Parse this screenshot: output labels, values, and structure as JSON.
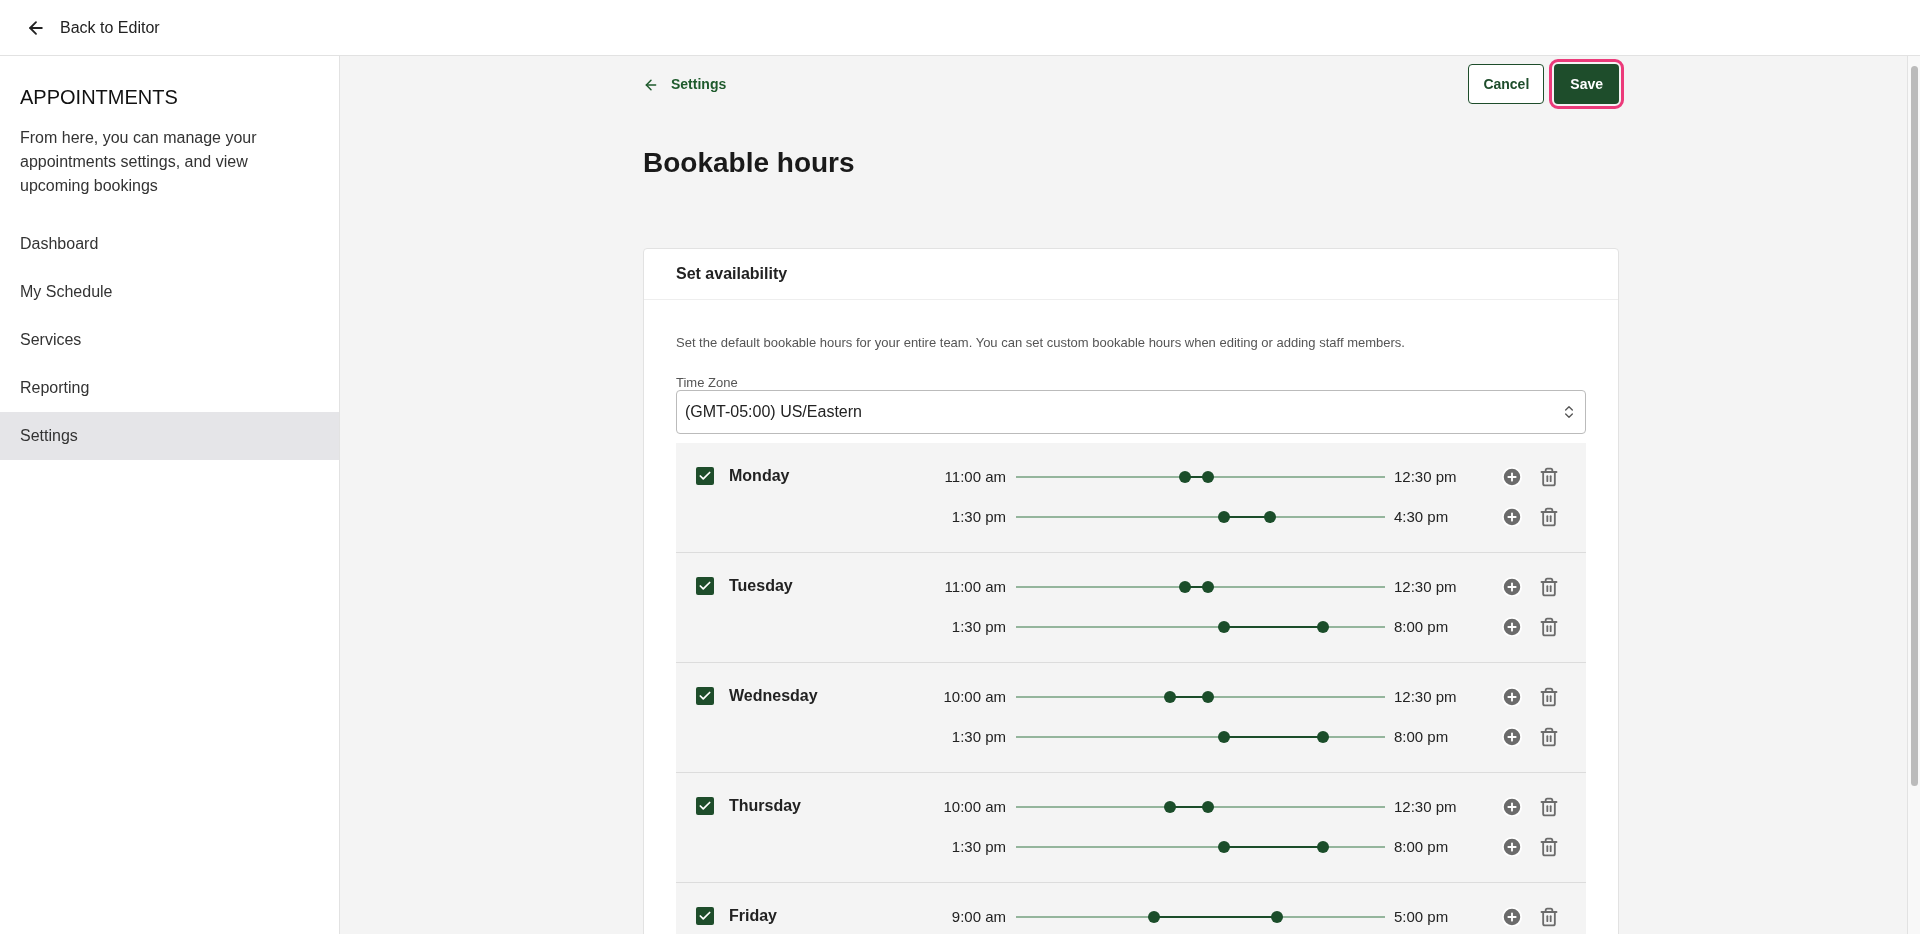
{
  "top_bar": {
    "back_link": "Back to Editor"
  },
  "sidebar": {
    "title": "APPOINTMENTS",
    "description": "From here, you can manage your appointments settings, and view upcoming bookings",
    "items": [
      {
        "label": "Dashboard",
        "selected": false
      },
      {
        "label": "My Schedule",
        "selected": false
      },
      {
        "label": "Services",
        "selected": false
      },
      {
        "label": "Reporting",
        "selected": false
      },
      {
        "label": "Settings",
        "selected": true
      }
    ]
  },
  "page": {
    "breadcrumb": "Settings",
    "title": "Bookable hours",
    "buttons": [
      {
        "label": "Cancel",
        "kind": "secondary",
        "focused": false
      },
      {
        "label": "Save",
        "kind": "primary",
        "focused": true
      }
    ]
  },
  "availability": {
    "title": "Set availability",
    "description": "Set the default bookable hours for your entire team. You can set custom bookable hours when editing or adding staff members.",
    "time_zone": {
      "label": "Time Zone",
      "value": "(GMT-05:00) US/Eastern"
    },
    "days": [
      {
        "name": "Monday",
        "checked": true,
        "slots": [
          {
            "start": "11:00 am",
            "end": "12:30 pm",
            "thumbs": [
              {
                "level": 0.458
              },
              {
                "level": 0.521
              }
            ]
          },
          {
            "start": "1:30 pm",
            "end": "4:30 pm",
            "thumbs": [
              {
                "level": 0.5625
              },
              {
                "level": 0.6875
              }
            ]
          }
        ]
      },
      {
        "name": "Tuesday",
        "checked": true,
        "slots": [
          {
            "start": "11:00 am",
            "end": "12:30 pm",
            "thumbs": [
              {
                "level": 0.458
              },
              {
                "level": 0.521
              }
            ]
          },
          {
            "start": "1:30 pm",
            "end": "8:00 pm",
            "thumbs": [
              {
                "level": 0.5625
              },
              {
                "level": 0.833
              }
            ]
          }
        ]
      },
      {
        "name": "Wednesday",
        "checked": true,
        "slots": [
          {
            "start": "10:00 am",
            "end": "12:30 pm",
            "thumbs": [
              {
                "level": 0.417
              },
              {
                "level": 0.521
              }
            ]
          },
          {
            "start": "1:30 pm",
            "end": "8:00 pm",
            "thumbs": [
              {
                "level": 0.5625
              },
              {
                "level": 0.833
              }
            ]
          }
        ]
      },
      {
        "name": "Thursday",
        "checked": true,
        "slots": [
          {
            "start": "10:00 am",
            "end": "12:30 pm",
            "thumbs": [
              {
                "level": 0.417
              },
              {
                "level": 0.521
              }
            ]
          },
          {
            "start": "1:30 pm",
            "end": "8:00 pm",
            "thumbs": [
              {
                "level": 0.5625
              },
              {
                "level": 0.833
              }
            ]
          }
        ]
      },
      {
        "name": "Friday",
        "checked": true,
        "slots": [
          {
            "start": "9:00 am",
            "end": "5:00 pm",
            "thumbs": [
              {
                "level": 0.375
              },
              {
                "level": 0.708
              }
            ]
          }
        ]
      }
    ]
  }
}
